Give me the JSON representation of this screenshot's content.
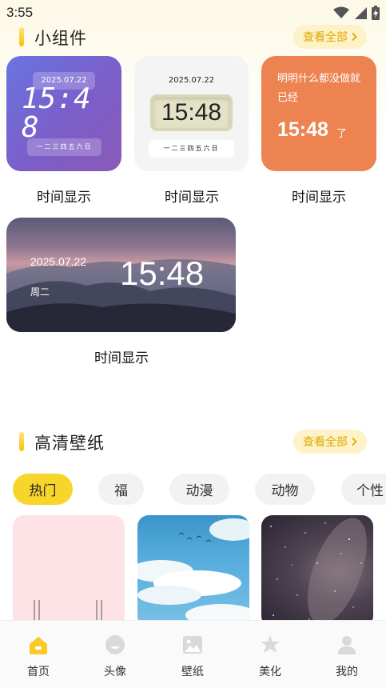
{
  "status_bar": {
    "time": "3:55"
  },
  "widgets_section": {
    "title": "小组件",
    "view_all": "查看全部"
  },
  "widgets": [
    {
      "date": "2025.07.22",
      "time": "15:48",
      "weekdays": "一二三四五六日",
      "label": "时间显示"
    },
    {
      "date": "2025.07.22",
      "time": "15:48",
      "weekdays": "一二三四五六日",
      "label": "时间显示"
    },
    {
      "text": "明明什么都没做就已经",
      "time": "15:48",
      "suffix": "了",
      "label": "时间显示"
    },
    {
      "date": "2025.07.22",
      "weekday": "周二",
      "time": "15:48",
      "label": "时间显示"
    }
  ],
  "wallpaper_section": {
    "title": "高清壁纸",
    "view_all": "查看全部"
  },
  "tags": [
    "热门",
    "福",
    "动漫",
    "动物",
    "个性"
  ],
  "active_tag": "热门",
  "bottom_nav": [
    {
      "label": "首页",
      "icon": "home-icon",
      "active": true
    },
    {
      "label": "头像",
      "icon": "avatar-icon",
      "active": false
    },
    {
      "label": "壁纸",
      "icon": "wallpaper-icon",
      "active": false
    },
    {
      "label": "美化",
      "icon": "beautify-icon",
      "active": false
    },
    {
      "label": "我的",
      "icon": "profile-icon",
      "active": false
    }
  ],
  "colors": {
    "accent": "#f8d52a",
    "accent_text": "#e0a800",
    "nav_inactive": "#d9d9d9"
  }
}
